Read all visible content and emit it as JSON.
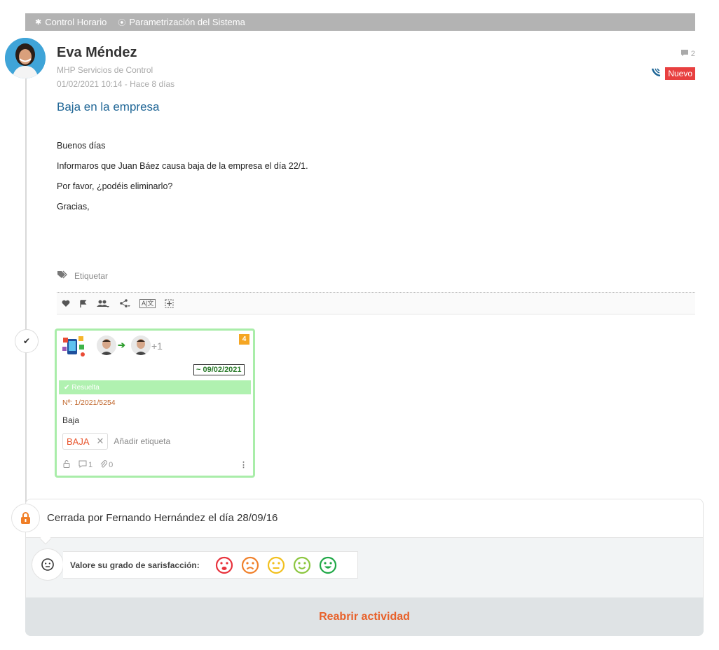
{
  "breadcrumb": [
    {
      "label": "Control Horario",
      "icon": "tools-icon"
    },
    {
      "label": "Parametrización del Sistema",
      "icon": "target-icon"
    }
  ],
  "post": {
    "author": "Eva Méndez",
    "company": "MHP Servicios de Control",
    "date": "01/02/2021 10:14 - Hace 8 días",
    "comment_count": "2",
    "status_badge": "Nuevo",
    "subject": "Baja en la empresa",
    "body": [
      "Buenos días",
      "Informaros que  Juan Báez  causa baja de la empresa el día 22/1.",
      "Por favor, ¿podéis eliminarlo?",
      "Gracias,"
    ],
    "tag_label": "Etiquetar",
    "toolbar": {
      "translate": "A|文"
    }
  },
  "card": {
    "count": "4",
    "more_assignees": "+1",
    "due_date": "~ 09/02/2021",
    "status": "Resuelta",
    "number": "Nº: 1/2021/5254",
    "title": "Baja",
    "tag": "BAJA",
    "tag_remove": "✕",
    "add_tag_placeholder": "Añadir etiqueta",
    "comments": "1",
    "attachments": "0"
  },
  "closure": {
    "text": "Cerrada por Fernando Hernández el día 28/09/16",
    "rating_label": "Valore su grado de sarisfacción:",
    "reopen_label": "Reabrir actividad",
    "rating_colors": [
      "#e8323c",
      "#f0802a",
      "#f2c01e",
      "#8cc63f",
      "#1fa846"
    ]
  },
  "colors": {
    "accent_blue": "#1f6696",
    "badge_red": "#e84040",
    "reopen_orange": "#e8612a",
    "card_border": "#a9eda9"
  }
}
